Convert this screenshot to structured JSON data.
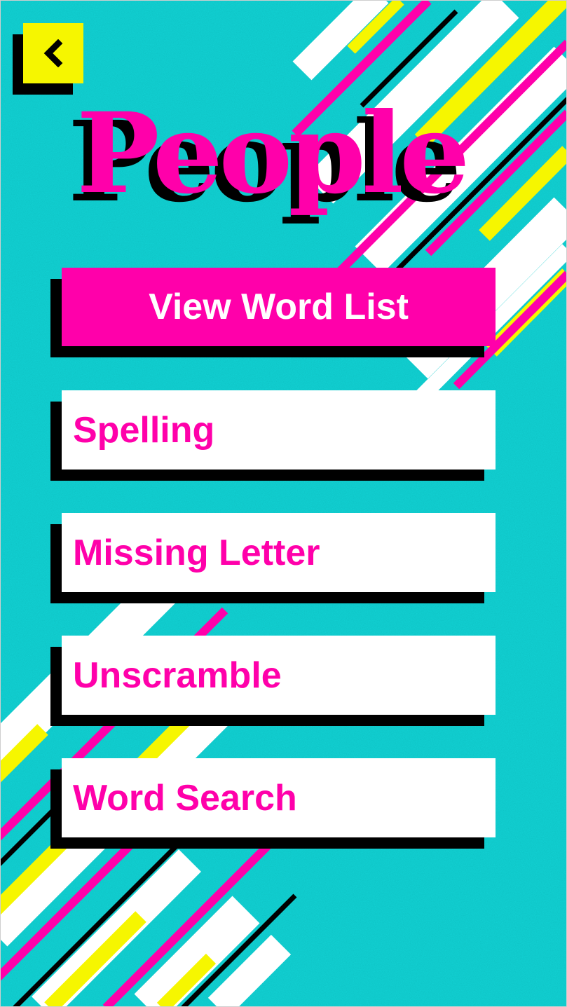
{
  "screen": {
    "title": "People"
  },
  "back": {
    "icon": "chevron-left-icon"
  },
  "primary_action": {
    "label": "View Word List"
  },
  "activities": [
    {
      "label": "Spelling"
    },
    {
      "label": "Missing Letter"
    },
    {
      "label": "Unscramble"
    },
    {
      "label": "Word Search"
    }
  ],
  "colors": {
    "background": "#12d0d2",
    "accent_pink": "#ff00aa",
    "accent_yellow": "#f6f600",
    "shadow": "#000000",
    "button_white": "#ffffff"
  }
}
